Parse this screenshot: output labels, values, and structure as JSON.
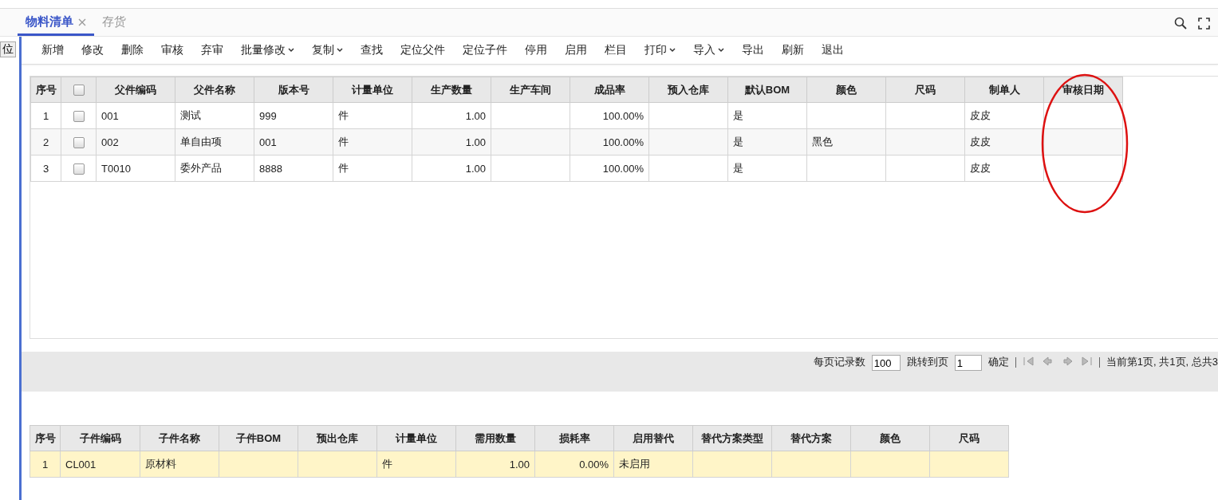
{
  "tabs": [
    {
      "label": "物料清单",
      "selected": true,
      "closable": true
    },
    {
      "label": "存货",
      "selected": false,
      "closable": false
    }
  ],
  "side_button": "位",
  "toolbar": [
    {
      "label": "新增",
      "has_menu": false
    },
    {
      "label": "修改",
      "has_menu": false
    },
    {
      "label": "删除",
      "has_menu": false
    },
    {
      "label": "审核",
      "has_menu": false
    },
    {
      "label": "弃审",
      "has_menu": false
    },
    {
      "label": "批量修改",
      "has_menu": true
    },
    {
      "label": "复制",
      "has_menu": true
    },
    {
      "label": "查找",
      "has_menu": false
    },
    {
      "label": "定位父件",
      "has_menu": false
    },
    {
      "label": "定位子件",
      "has_menu": false
    },
    {
      "label": "停用",
      "has_menu": false
    },
    {
      "label": "启用",
      "has_menu": false
    },
    {
      "label": "栏目",
      "has_menu": false
    },
    {
      "label": "打印",
      "has_menu": true
    },
    {
      "label": "导入",
      "has_menu": true
    },
    {
      "label": "导出",
      "has_menu": false
    },
    {
      "label": "刷新",
      "has_menu": false
    },
    {
      "label": "退出",
      "has_menu": false
    }
  ],
  "parent_table": {
    "columns": [
      {
        "label": "序号",
        "kind": "index"
      },
      {
        "kind": "checkbox"
      },
      {
        "label": "父件编码",
        "kind": "text"
      },
      {
        "label": "父件名称",
        "kind": "text"
      },
      {
        "label": "版本号",
        "kind": "text"
      },
      {
        "label": "计量单位",
        "kind": "text"
      },
      {
        "label": "生产数量",
        "kind": "number"
      },
      {
        "label": "生产车间",
        "kind": "text"
      },
      {
        "label": "成品率",
        "kind": "number"
      },
      {
        "label": "预入仓库",
        "kind": "text"
      },
      {
        "label": "默认BOM",
        "kind": "text"
      },
      {
        "label": "颜色",
        "kind": "text"
      },
      {
        "label": "尺码",
        "kind": "text"
      },
      {
        "label": "制单人",
        "kind": "text"
      },
      {
        "label": "审核日期",
        "kind": "text"
      }
    ],
    "header_checked": false,
    "rows": [
      {
        "checked": false,
        "cells": [
          "1",
          "",
          "001",
          "测试",
          "999",
          "件",
          "1.00",
          "",
          "100.00%",
          "",
          "是",
          "",
          "",
          "皮皮",
          ""
        ]
      },
      {
        "checked": false,
        "cells": [
          "2",
          "",
          "002",
          "单自由项",
          "001",
          "件",
          "1.00",
          "",
          "100.00%",
          "",
          "是",
          "黑色",
          "",
          "皮皮",
          ""
        ]
      },
      {
        "checked": false,
        "cells": [
          "3",
          "",
          "T0010",
          "委外产品",
          "8888",
          "件",
          "1.00",
          "",
          "100.00%",
          "",
          "是",
          "",
          "",
          "皮皮",
          ""
        ]
      }
    ]
  },
  "pager": {
    "per_page_label": "每页记录数",
    "per_page": "100",
    "goto_label": "跳转到页",
    "goto_page": "1",
    "confirm": "确定",
    "status": "当前第1页, 共1页, 总共3"
  },
  "child_table": {
    "columns": [
      {
        "label": "序号",
        "kind": "index"
      },
      {
        "label": "子件编码",
        "kind": "text"
      },
      {
        "label": "子件名称",
        "kind": "text"
      },
      {
        "label": "子件BOM",
        "kind": "text"
      },
      {
        "label": "预出仓库",
        "kind": "text"
      },
      {
        "label": "计量单位",
        "kind": "text"
      },
      {
        "label": "需用数量",
        "kind": "number"
      },
      {
        "label": "损耗率",
        "kind": "number"
      },
      {
        "label": "启用替代",
        "kind": "text"
      },
      {
        "label": "替代方案类型",
        "kind": "text"
      },
      {
        "label": "替代方案",
        "kind": "text"
      },
      {
        "label": "颜色",
        "kind": "text"
      },
      {
        "label": "尺码",
        "kind": "text"
      }
    ],
    "rows": [
      {
        "selected": true,
        "cells": [
          "1",
          "CL001",
          "原材料",
          "",
          "",
          "件",
          "1.00",
          "0.00%",
          "未启用",
          "",
          "",
          "",
          ""
        ]
      }
    ]
  },
  "annotation": {
    "kind": "ellipse"
  }
}
